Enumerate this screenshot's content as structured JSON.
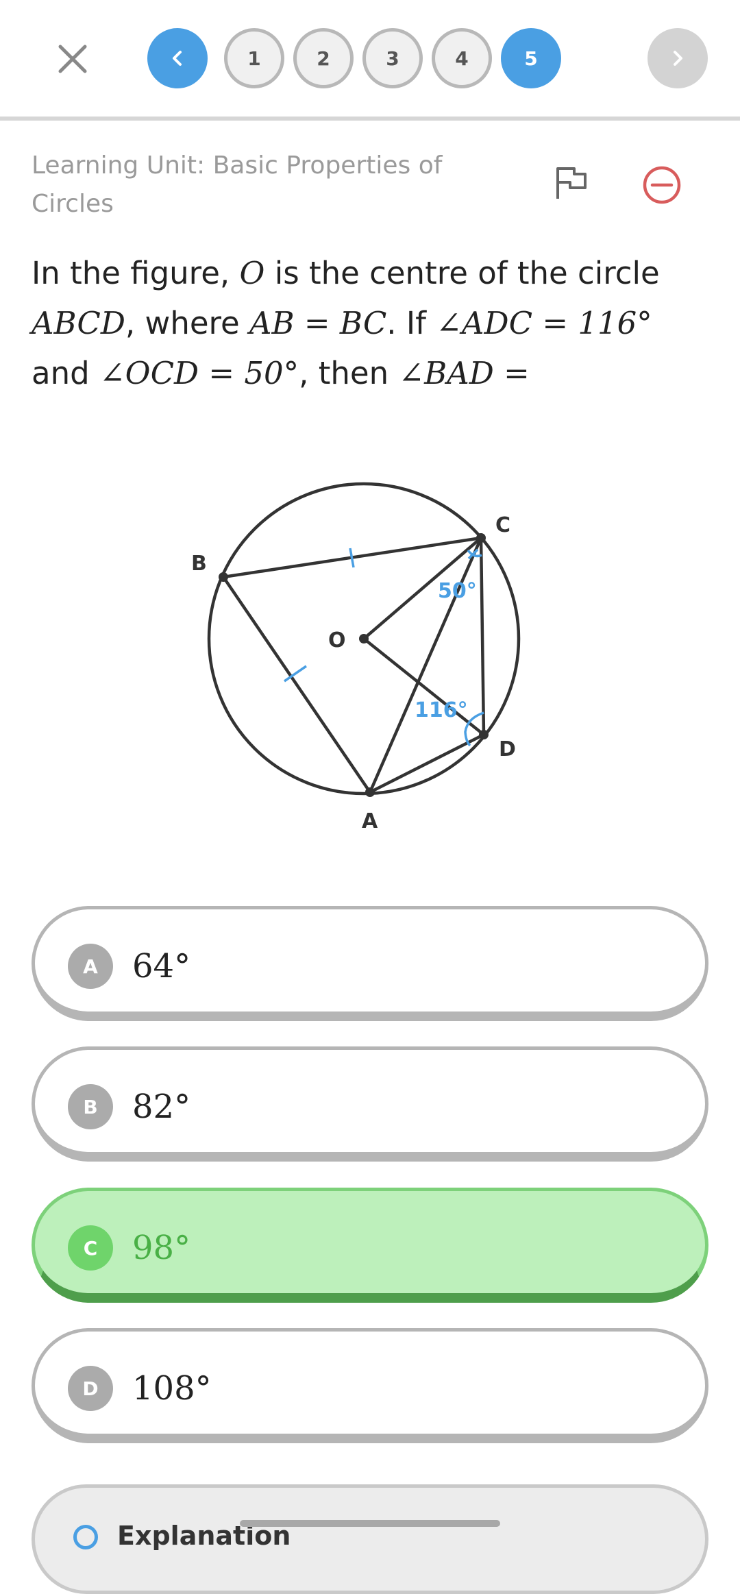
{
  "nav": {
    "prev_icon": "chevron-left-icon",
    "next_icon": "chevron-right-icon",
    "close_icon": "close-icon",
    "pages": [
      "1",
      "2",
      "3",
      "4",
      "5"
    ],
    "current_page": "5",
    "accent_color": "#4a9fe3"
  },
  "header": {
    "unit_title": "Learning Unit: Basic Properties of Circles",
    "flag_icon": "flag-icon",
    "remove_icon": "minus-circle-icon"
  },
  "question": {
    "parts": {
      "p1": "In the figure, ",
      "O": "O",
      "p2": " is the centre of the circle",
      "ABCD": "ABCD",
      "p3": ", where ",
      "eq1": "AB = BC",
      "p4": ". If ",
      "eq2": "∠ADC = 116°",
      "p5": "and ",
      "eq3": "∠OCD = 50°",
      "p6": ", then ",
      "eq4": "∠BAD ="
    }
  },
  "figure": {
    "points": {
      "A": "A",
      "B": "B",
      "C": "C",
      "D": "D",
      "O": "O"
    },
    "angle_ocd": "50°",
    "angle_adc": "116°",
    "mark_color": "#4a9fe3"
  },
  "options": [
    {
      "letter": "A",
      "value": "64°",
      "state": "default"
    },
    {
      "letter": "B",
      "value": "82°",
      "state": "default"
    },
    {
      "letter": "C",
      "value": "98°",
      "state": "correct"
    },
    {
      "letter": "D",
      "value": "108°",
      "state": "default"
    }
  ],
  "explanation": {
    "label": "Explanation",
    "icon": "search-icon"
  }
}
